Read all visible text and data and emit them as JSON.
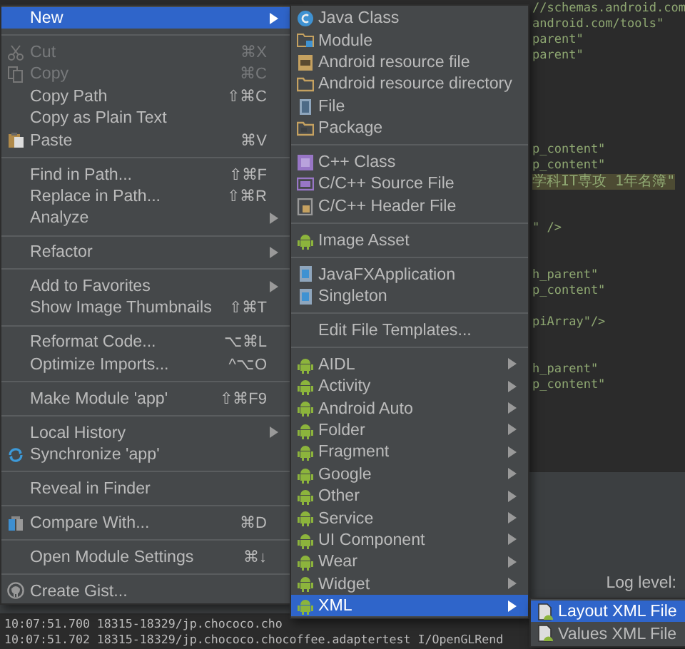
{
  "editor": {
    "lines": [
      {
        "text": "//schemas.android.com",
        "highlighted": false
      },
      {
        "text": "android.com/tools\"",
        "highlighted": false
      },
      {
        "text": "parent\"",
        "highlighted": false
      },
      {
        "text": "parent\"",
        "highlighted": false
      },
      {
        "text": "p_content\"",
        "highlighted": false
      },
      {
        "text": "p_content\"",
        "highlighted": false
      },
      {
        "text": "学科IT専攻  1年名簿\"",
        "highlighted": true
      },
      {
        "text": "\" />",
        "highlighted": false
      },
      {
        "text": "h_parent\"",
        "highlighted": false
      },
      {
        "text": "p_content\"",
        "highlighted": false
      },
      {
        "text": "piArray\"/>",
        "highlighted": false
      },
      {
        "text": "h_parent\"",
        "highlighted": false
      },
      {
        "text": "p_content\"",
        "highlighted": false
      }
    ]
  },
  "log_panel": {
    "log_level_label": "Log level:",
    "lines": [
      "10:07:51.700  18315-18329/jp.chococo.cho",
      "10:07:51.702  18315-18329/jp.chococo.chocoffee.adaptertest I/OpenGLRend"
    ]
  },
  "context_menu": {
    "sections": [
      [
        {
          "label": "New",
          "kind": "plain",
          "submenu": true,
          "disabled": false,
          "selected": true
        }
      ],
      [
        {
          "label": "Cut",
          "shortcut": "⌘X",
          "kind": "scissors",
          "submenu": false,
          "disabled": true,
          "selected": false
        },
        {
          "label": "Copy",
          "shortcut": "⌘C",
          "kind": "copy",
          "submenu": false,
          "disabled": true,
          "selected": false
        },
        {
          "label": "Copy Path",
          "shortcut": "⇧⌘C",
          "kind": "plain",
          "submenu": false,
          "disabled": false,
          "selected": false
        },
        {
          "label": "Copy as Plain Text",
          "kind": "plain",
          "submenu": false,
          "disabled": false,
          "selected": false
        },
        {
          "label": "Paste",
          "shortcut": "⌘V",
          "kind": "paste",
          "submenu": false,
          "disabled": false,
          "selected": false
        }
      ],
      [
        {
          "label": "Find in Path...",
          "shortcut": "⇧⌘F",
          "kind": "plain",
          "submenu": false,
          "disabled": false,
          "selected": false
        },
        {
          "label": "Replace in Path...",
          "shortcut": "⇧⌘R",
          "kind": "plain",
          "submenu": false,
          "disabled": false,
          "selected": false
        },
        {
          "label": "Analyze",
          "kind": "plain",
          "submenu": true,
          "disabled": false,
          "selected": false
        }
      ],
      [
        {
          "label": "Refactor",
          "kind": "plain",
          "submenu": true,
          "disabled": false,
          "selected": false
        }
      ],
      [
        {
          "label": "Add to Favorites",
          "kind": "plain",
          "submenu": true,
          "disabled": false,
          "selected": false
        },
        {
          "label": "Show Image Thumbnails",
          "shortcut": "⇧⌘T",
          "kind": "plain",
          "submenu": false,
          "disabled": false,
          "selected": false
        }
      ],
      [
        {
          "label": "Reformat Code...",
          "shortcut": "⌥⌘L",
          "kind": "plain",
          "submenu": false,
          "disabled": false,
          "selected": false
        },
        {
          "label": "Optimize Imports...",
          "shortcut": "^⌥O",
          "kind": "plain",
          "submenu": false,
          "disabled": false,
          "selected": false
        }
      ],
      [
        {
          "label": "Make Module 'app'",
          "shortcut": "⇧⌘F9",
          "kind": "plain",
          "submenu": false,
          "disabled": false,
          "selected": false
        }
      ],
      [
        {
          "label": "Local History",
          "kind": "plain",
          "submenu": true,
          "disabled": false,
          "selected": false
        },
        {
          "label": "Synchronize 'app'",
          "kind": "sync",
          "submenu": false,
          "disabled": false,
          "selected": false
        }
      ],
      [
        {
          "label": "Reveal in Finder",
          "kind": "plain",
          "submenu": false,
          "disabled": false,
          "selected": false
        }
      ],
      [
        {
          "label": "Compare With...",
          "shortcut": "⌘D",
          "kind": "compare",
          "submenu": false,
          "disabled": false,
          "selected": false
        }
      ],
      [
        {
          "label": "Open Module Settings",
          "shortcut": "⌘↓",
          "kind": "plain",
          "submenu": false,
          "disabled": false,
          "selected": false
        }
      ],
      [
        {
          "label": "Create Gist...",
          "kind": "gist",
          "submenu": false,
          "disabled": false,
          "selected": false
        }
      ]
    ]
  },
  "new_submenu": {
    "sections": [
      [
        {
          "label": "Java Class",
          "kind": "class",
          "submenu": false,
          "selected": false
        },
        {
          "label": "Module",
          "kind": "module",
          "submenu": false,
          "selected": false
        },
        {
          "label": "Android resource file",
          "kind": "resource",
          "submenu": false,
          "selected": false
        },
        {
          "label": "Android resource directory",
          "kind": "folder",
          "submenu": false,
          "selected": false
        },
        {
          "label": "File",
          "kind": "file",
          "submenu": false,
          "selected": false
        },
        {
          "label": "Package",
          "kind": "package",
          "submenu": false,
          "selected": false
        }
      ],
      [
        {
          "label": "C++ Class",
          "kind": "cppclass",
          "submenu": false,
          "selected": false
        },
        {
          "label": "C/C++ Source File",
          "kind": "source",
          "submenu": false,
          "selected": false
        },
        {
          "label": "C/C++ Header File",
          "kind": "header",
          "submenu": false,
          "selected": false
        }
      ],
      [
        {
          "label": "Image Asset",
          "kind": "android",
          "submenu": false,
          "selected": false
        }
      ],
      [
        {
          "label": "JavaFXApplication",
          "kind": "javafile",
          "submenu": false,
          "selected": false
        },
        {
          "label": "Singleton",
          "kind": "javafile",
          "submenu": false,
          "selected": false
        }
      ],
      [
        {
          "label": "Edit File Templates...",
          "kind": "plain",
          "submenu": false,
          "selected": false
        }
      ],
      [
        {
          "label": "AIDL",
          "kind": "android",
          "submenu": true,
          "selected": false
        },
        {
          "label": "Activity",
          "kind": "android",
          "submenu": true,
          "selected": false
        },
        {
          "label": "Android Auto",
          "kind": "android",
          "submenu": true,
          "selected": false
        },
        {
          "label": "Folder",
          "kind": "android",
          "submenu": true,
          "selected": false
        },
        {
          "label": "Fragment",
          "kind": "android",
          "submenu": true,
          "selected": false
        },
        {
          "label": "Google",
          "kind": "android",
          "submenu": true,
          "selected": false
        },
        {
          "label": "Other",
          "kind": "android",
          "submenu": true,
          "selected": false
        },
        {
          "label": "Service",
          "kind": "android",
          "submenu": true,
          "selected": false
        },
        {
          "label": "UI Component",
          "kind": "android",
          "submenu": true,
          "selected": false
        },
        {
          "label": "Wear",
          "kind": "android",
          "submenu": true,
          "selected": false
        },
        {
          "label": "Widget",
          "kind": "android",
          "submenu": true,
          "selected": false
        },
        {
          "label": "XML",
          "kind": "android",
          "submenu": true,
          "selected": true
        }
      ]
    ]
  },
  "xml_submenu": {
    "items": [
      {
        "label": "Layout XML File",
        "kind": "xml",
        "selected": true
      },
      {
        "label": "Values XML File",
        "kind": "xml",
        "selected": false
      }
    ]
  }
}
